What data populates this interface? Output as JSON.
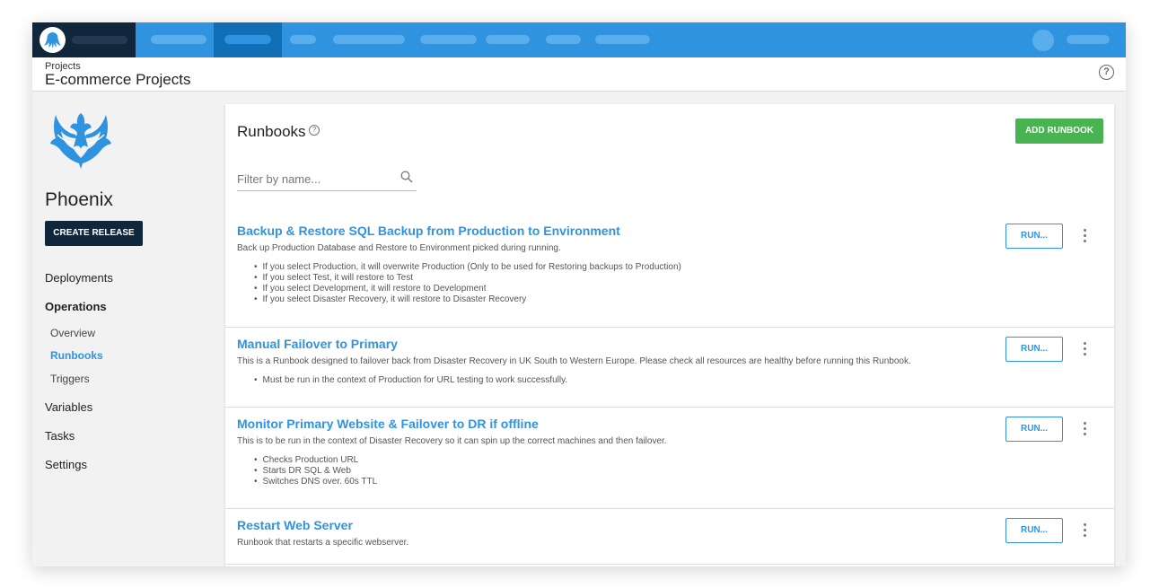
{
  "header": {
    "breadcrumb": "Projects",
    "project_group_title": "E-commerce Projects"
  },
  "sidebar": {
    "project_name": "Phoenix",
    "create_release_label": "CREATE RELEASE",
    "items": [
      {
        "label": "Deployments"
      },
      {
        "label": "Operations"
      },
      {
        "label": "Overview"
      },
      {
        "label": "Runbooks"
      },
      {
        "label": "Triggers"
      },
      {
        "label": "Variables"
      },
      {
        "label": "Tasks"
      },
      {
        "label": "Settings"
      }
    ],
    "active_item": "Runbooks"
  },
  "main": {
    "title": "Runbooks",
    "add_runbook_label": "ADD RUNBOOK",
    "filter_placeholder": "Filter by name...",
    "runbooks": [
      {
        "title": "Backup & Restore SQL Backup from Production to Environment",
        "description": "Back up Production Database and Restore to Environment picked during running.",
        "bullets": [
          "If you select Production, it will overwrite Production (Only to be used for Restoring backups to Production)",
          "If you select Test, it will restore to Test",
          "If you select Development, it will restore to Development",
          "If you select Disaster Recovery, it will restore to Disaster Recovery"
        ],
        "run_label": "RUN..."
      },
      {
        "title": "Manual Failover to Primary",
        "description": "This is a Runbook designed to failover back from Disaster Recovery in UK South to Western Europe. Please check all resources are healthy before running this Runbook.",
        "bullets": [
          "Must be run in the context of Production for URL testing to work successfully."
        ],
        "run_label": "RUN..."
      },
      {
        "title": "Monitor Primary Website & Failover to DR if offline",
        "description": "This is to be run in the context of Disaster Recovery so it can spin up the correct machines and then failover.",
        "bullets": [
          "Checks Production URL",
          "Starts DR SQL & Web",
          "Switches DNS over. 60s TTL"
        ],
        "run_label": "RUN..."
      },
      {
        "title": "Restart Web Server",
        "description": "Runbook that restarts a specific webserver.",
        "bullets": [],
        "run_label": "RUN..."
      }
    ]
  },
  "colors": {
    "nav_blue": "#2f93e0",
    "nav_dark": "#10263a",
    "link_blue": "#2f93e0",
    "add_green": "#48b350"
  }
}
